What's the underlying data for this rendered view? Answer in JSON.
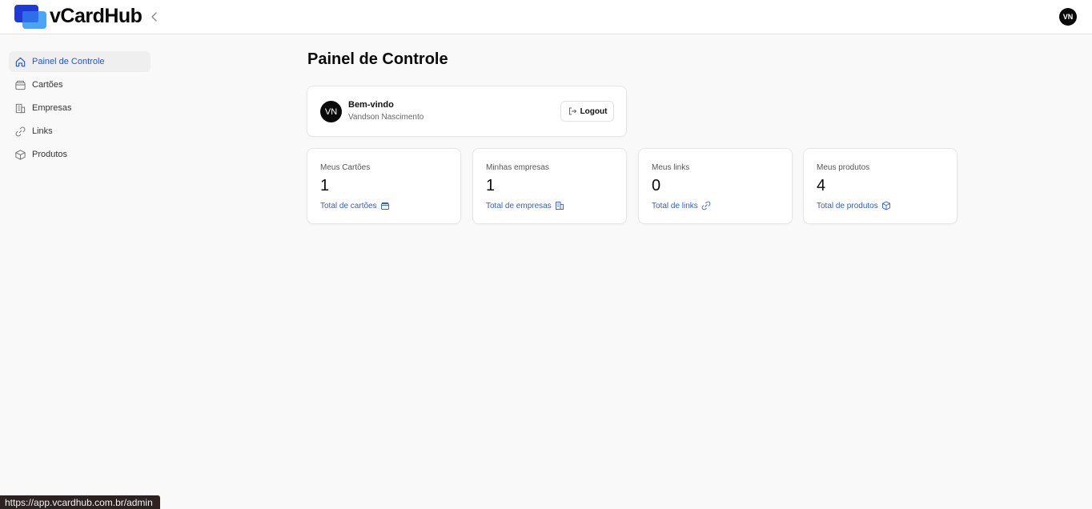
{
  "header": {
    "brand": "vCardHub",
    "avatar_initials": "VN"
  },
  "sidebar": {
    "items": [
      {
        "label": "Painel de Controle",
        "icon": "home-icon",
        "active": true
      },
      {
        "label": "Cartões",
        "icon": "wallet-icon",
        "active": false
      },
      {
        "label": "Empresas",
        "icon": "building-icon",
        "active": false
      },
      {
        "label": "Links",
        "icon": "link-icon",
        "active": false
      },
      {
        "label": "Produtos",
        "icon": "box-icon",
        "active": false
      }
    ]
  },
  "main": {
    "title": "Painel de Controle",
    "welcome": {
      "initials": "VN",
      "greeting": "Bem-vindo",
      "user_name": "Vandson Nascimento",
      "logout_label": "Logout"
    },
    "stats": [
      {
        "label": "Meus Cartões",
        "value": "1",
        "footer": "Total de cartões",
        "icon": "wallet-icon"
      },
      {
        "label": "Minhas empresas",
        "value": "1",
        "footer": "Total de empresas",
        "icon": "building-icon"
      },
      {
        "label": "Meus links",
        "value": "0",
        "footer": "Total de links",
        "icon": "link-icon"
      },
      {
        "label": "Meus produtos",
        "value": "4",
        "footer": "Total de produtos",
        "icon": "box-icon"
      }
    ]
  },
  "statusbar": {
    "url": "https://app.vcardhub.com.br/admin"
  },
  "colors": {
    "accent": "#2457c5",
    "brand_dark": "#1f3bd6",
    "brand_light": "#4aa6f2"
  }
}
